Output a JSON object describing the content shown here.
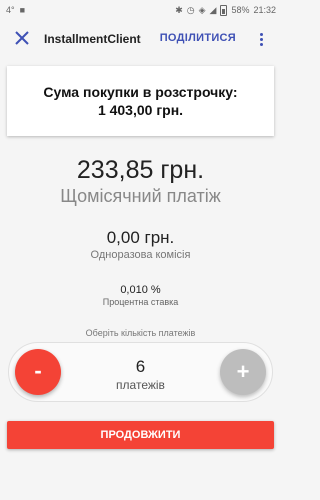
{
  "status_bar": {
    "left_text": "4°",
    "battery_percent": "58%",
    "time": "21:32",
    "icons": [
      "message-icon",
      "bluetooth-icon",
      "alarm-icon",
      "wifi-icon",
      "signal-icon",
      "battery-icon"
    ]
  },
  "app_bar": {
    "title": "InstallmentClient",
    "share_label": "ПОДІЛИТИСЯ",
    "accent_color": "#3f51b5"
  },
  "summary_card": {
    "title": "Сума покупки в розстрочку:",
    "amount": "1 403,00 грн."
  },
  "monthly": {
    "amount": "233,85 грн.",
    "label": "Щомісячний платіж"
  },
  "fee": {
    "amount": "0,00 грн.",
    "label": "Одноразова комісія"
  },
  "rate": {
    "amount": "0,010 %",
    "label": "Процентна ставка"
  },
  "payments": {
    "hint": "Оберіть кількість платежів",
    "count": "6",
    "unit": "платежів",
    "minus_label": "-",
    "plus_label": "+"
  },
  "continue_label": "ПРОДОВЖИТИ",
  "colors": {
    "primary_red": "#f44336",
    "disabled_gray": "#bdbdbd"
  }
}
